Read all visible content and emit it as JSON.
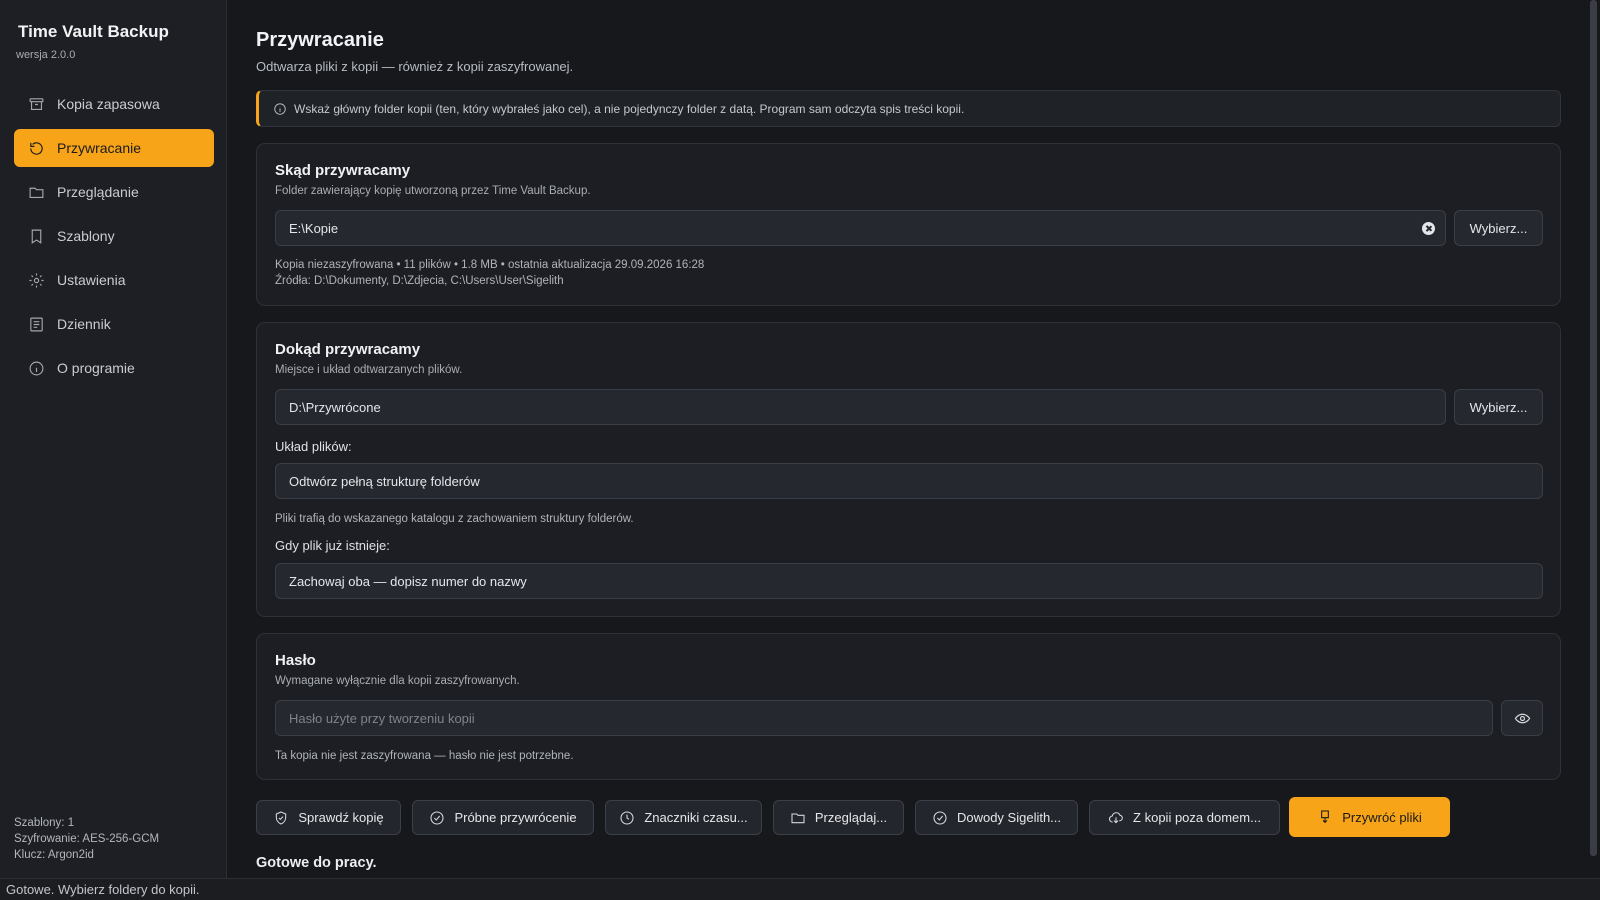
{
  "app": {
    "title": "Time Vault Backup",
    "version": "wersja 2.0.0"
  },
  "sidebar": {
    "items": [
      {
        "label": "Kopia zapasowa",
        "icon": "archive-icon",
        "active": false
      },
      {
        "label": "Przywracanie",
        "icon": "restore-icon",
        "active": true
      },
      {
        "label": "Przeglądanie",
        "icon": "folder-icon",
        "active": false
      },
      {
        "label": "Szablony",
        "icon": "bookmark-icon",
        "active": false
      },
      {
        "label": "Ustawienia",
        "icon": "gear-icon",
        "active": false
      },
      {
        "label": "Dziennik",
        "icon": "log-icon",
        "active": false
      },
      {
        "label": "O programie",
        "icon": "info-icon",
        "active": false
      }
    ],
    "info": {
      "templates": "Szablony: 1",
      "encryption": "Szyfrowanie: AES-256-GCM",
      "key": "Klucz: Argon2id"
    }
  },
  "page": {
    "title": "Przywracanie",
    "subtitle": "Odtwarza pliki z kopii — również z kopii zaszyfrowanej.",
    "banner": "Wskaż główny folder kopii (ten, który wybrałeś jako cel), a nie pojedynczy folder z datą. Program sam odczyta spis treści kopii."
  },
  "source": {
    "title": "Skąd przywracamy",
    "subtitle": "Folder zawierający kopię utworzoną przez Time Vault Backup.",
    "path": "E:\\Kopie",
    "choose_label": "Wybierz...",
    "details": "Kopia niezaszyfrowana • 11 plików • 1.8 MB • ostatnia aktualizacja 29.09.2026 16:28",
    "sources": "Źródła: D:\\Dokumenty, D:\\Zdjecia, C:\\Users\\User\\Sigelith"
  },
  "target": {
    "title": "Dokąd przywracamy",
    "subtitle": "Miejsce i układ odtwarzanych plików.",
    "path": "D:\\Przywrócone",
    "choose_label": "Wybierz...",
    "layout_label": "Układ plików:",
    "layout_value": "Odtwórz pełną strukturę folderów",
    "layout_hint": "Pliki trafią do wskazanego katalogu z zachowaniem struktury folderów.",
    "exists_label": "Gdy plik już istnieje:",
    "exists_value": "Zachowaj oba — dopisz numer do nazwy"
  },
  "password": {
    "title": "Hasło",
    "subtitle": "Wymagane wyłącznie dla kopii zaszyfrowanych.",
    "placeholder": "Hasło użyte przy tworzeniu kopii",
    "hint": "Ta kopia nie jest zaszyfrowana — hasło nie jest potrzebne."
  },
  "actions": [
    {
      "label": "Sprawdź kopię",
      "icon": "shield-icon"
    },
    {
      "label": "Próbne przywrócenie",
      "icon": "check-circle-icon"
    },
    {
      "label": "Znaczniki czasu...",
      "icon": "clock-icon"
    },
    {
      "label": "Przeglądaj...",
      "icon": "folder-icon"
    },
    {
      "label": "Dowody Sigelith...",
      "icon": "check-circle-icon"
    },
    {
      "label": "Z kopii poza domem...",
      "icon": "cloud-download-icon"
    },
    {
      "label": "Przywróć pliki",
      "icon": "download-icon"
    }
  ],
  "status": {
    "ready": "Gotowe do pracy.",
    "bar": "Gotowe. Wybierz foldery do kopii."
  },
  "colors": {
    "accent": "#f7a418",
    "background": "#16181c",
    "panel": "#1c1e23"
  }
}
